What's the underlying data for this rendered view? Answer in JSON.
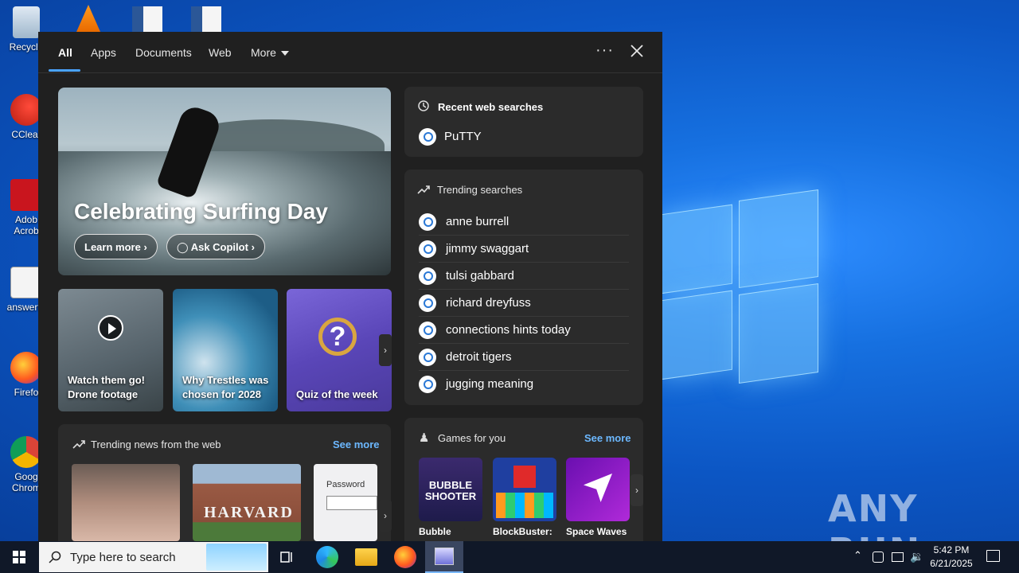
{
  "desktop": {
    "icons": [
      {
        "label": "Recycle"
      },
      {
        "label": "CClear"
      },
      {
        "label": "Adob Acrob"
      },
      {
        "label": "answerfe"
      },
      {
        "label": "Firefo"
      },
      {
        "label": "Goog Chrom"
      }
    ],
    "watermark": "ANY RUN"
  },
  "search_panel": {
    "tabs": [
      {
        "label": "All"
      },
      {
        "label": "Apps"
      },
      {
        "label": "Documents"
      },
      {
        "label": "Web"
      },
      {
        "label": "More"
      }
    ],
    "more_options": "···",
    "hero": {
      "title": "Celebrating Surfing Day",
      "learn_more": "Learn more",
      "ask_copilot": "Ask Copilot"
    },
    "tiles": [
      {
        "caption": "Watch them go! Drone footage"
      },
      {
        "caption": "Why Trestles was chosen for 2028"
      },
      {
        "caption": "Quiz of the week"
      }
    ],
    "recent": {
      "heading": "Recent web searches",
      "items": [
        "PuTTY"
      ]
    },
    "trending": {
      "heading": "Trending searches",
      "items": [
        "anne burrell",
        "jimmy swaggart",
        "tulsi gabbard",
        "richard dreyfuss",
        "connections hints today",
        "detroit tigers",
        "jugging meaning"
      ]
    },
    "news": {
      "heading": "Trending news from the web",
      "see_more": "See more",
      "items": [
        {
          "image_text": ""
        },
        {
          "image_text": "HARVARD"
        },
        {
          "image_text": "Password"
        }
      ]
    },
    "games": {
      "heading": "Games for you",
      "see_more": "See more",
      "items": [
        {
          "title": "Bubble",
          "art_text": "BUBBLE SHOOTER"
        },
        {
          "title": "BlockBuster:",
          "art_text": ""
        },
        {
          "title": "Space Waves",
          "art_text": ""
        }
      ]
    }
  },
  "taskbar": {
    "search_placeholder": "Type here to search",
    "time": "5:42 PM",
    "date": "6/21/2025"
  }
}
